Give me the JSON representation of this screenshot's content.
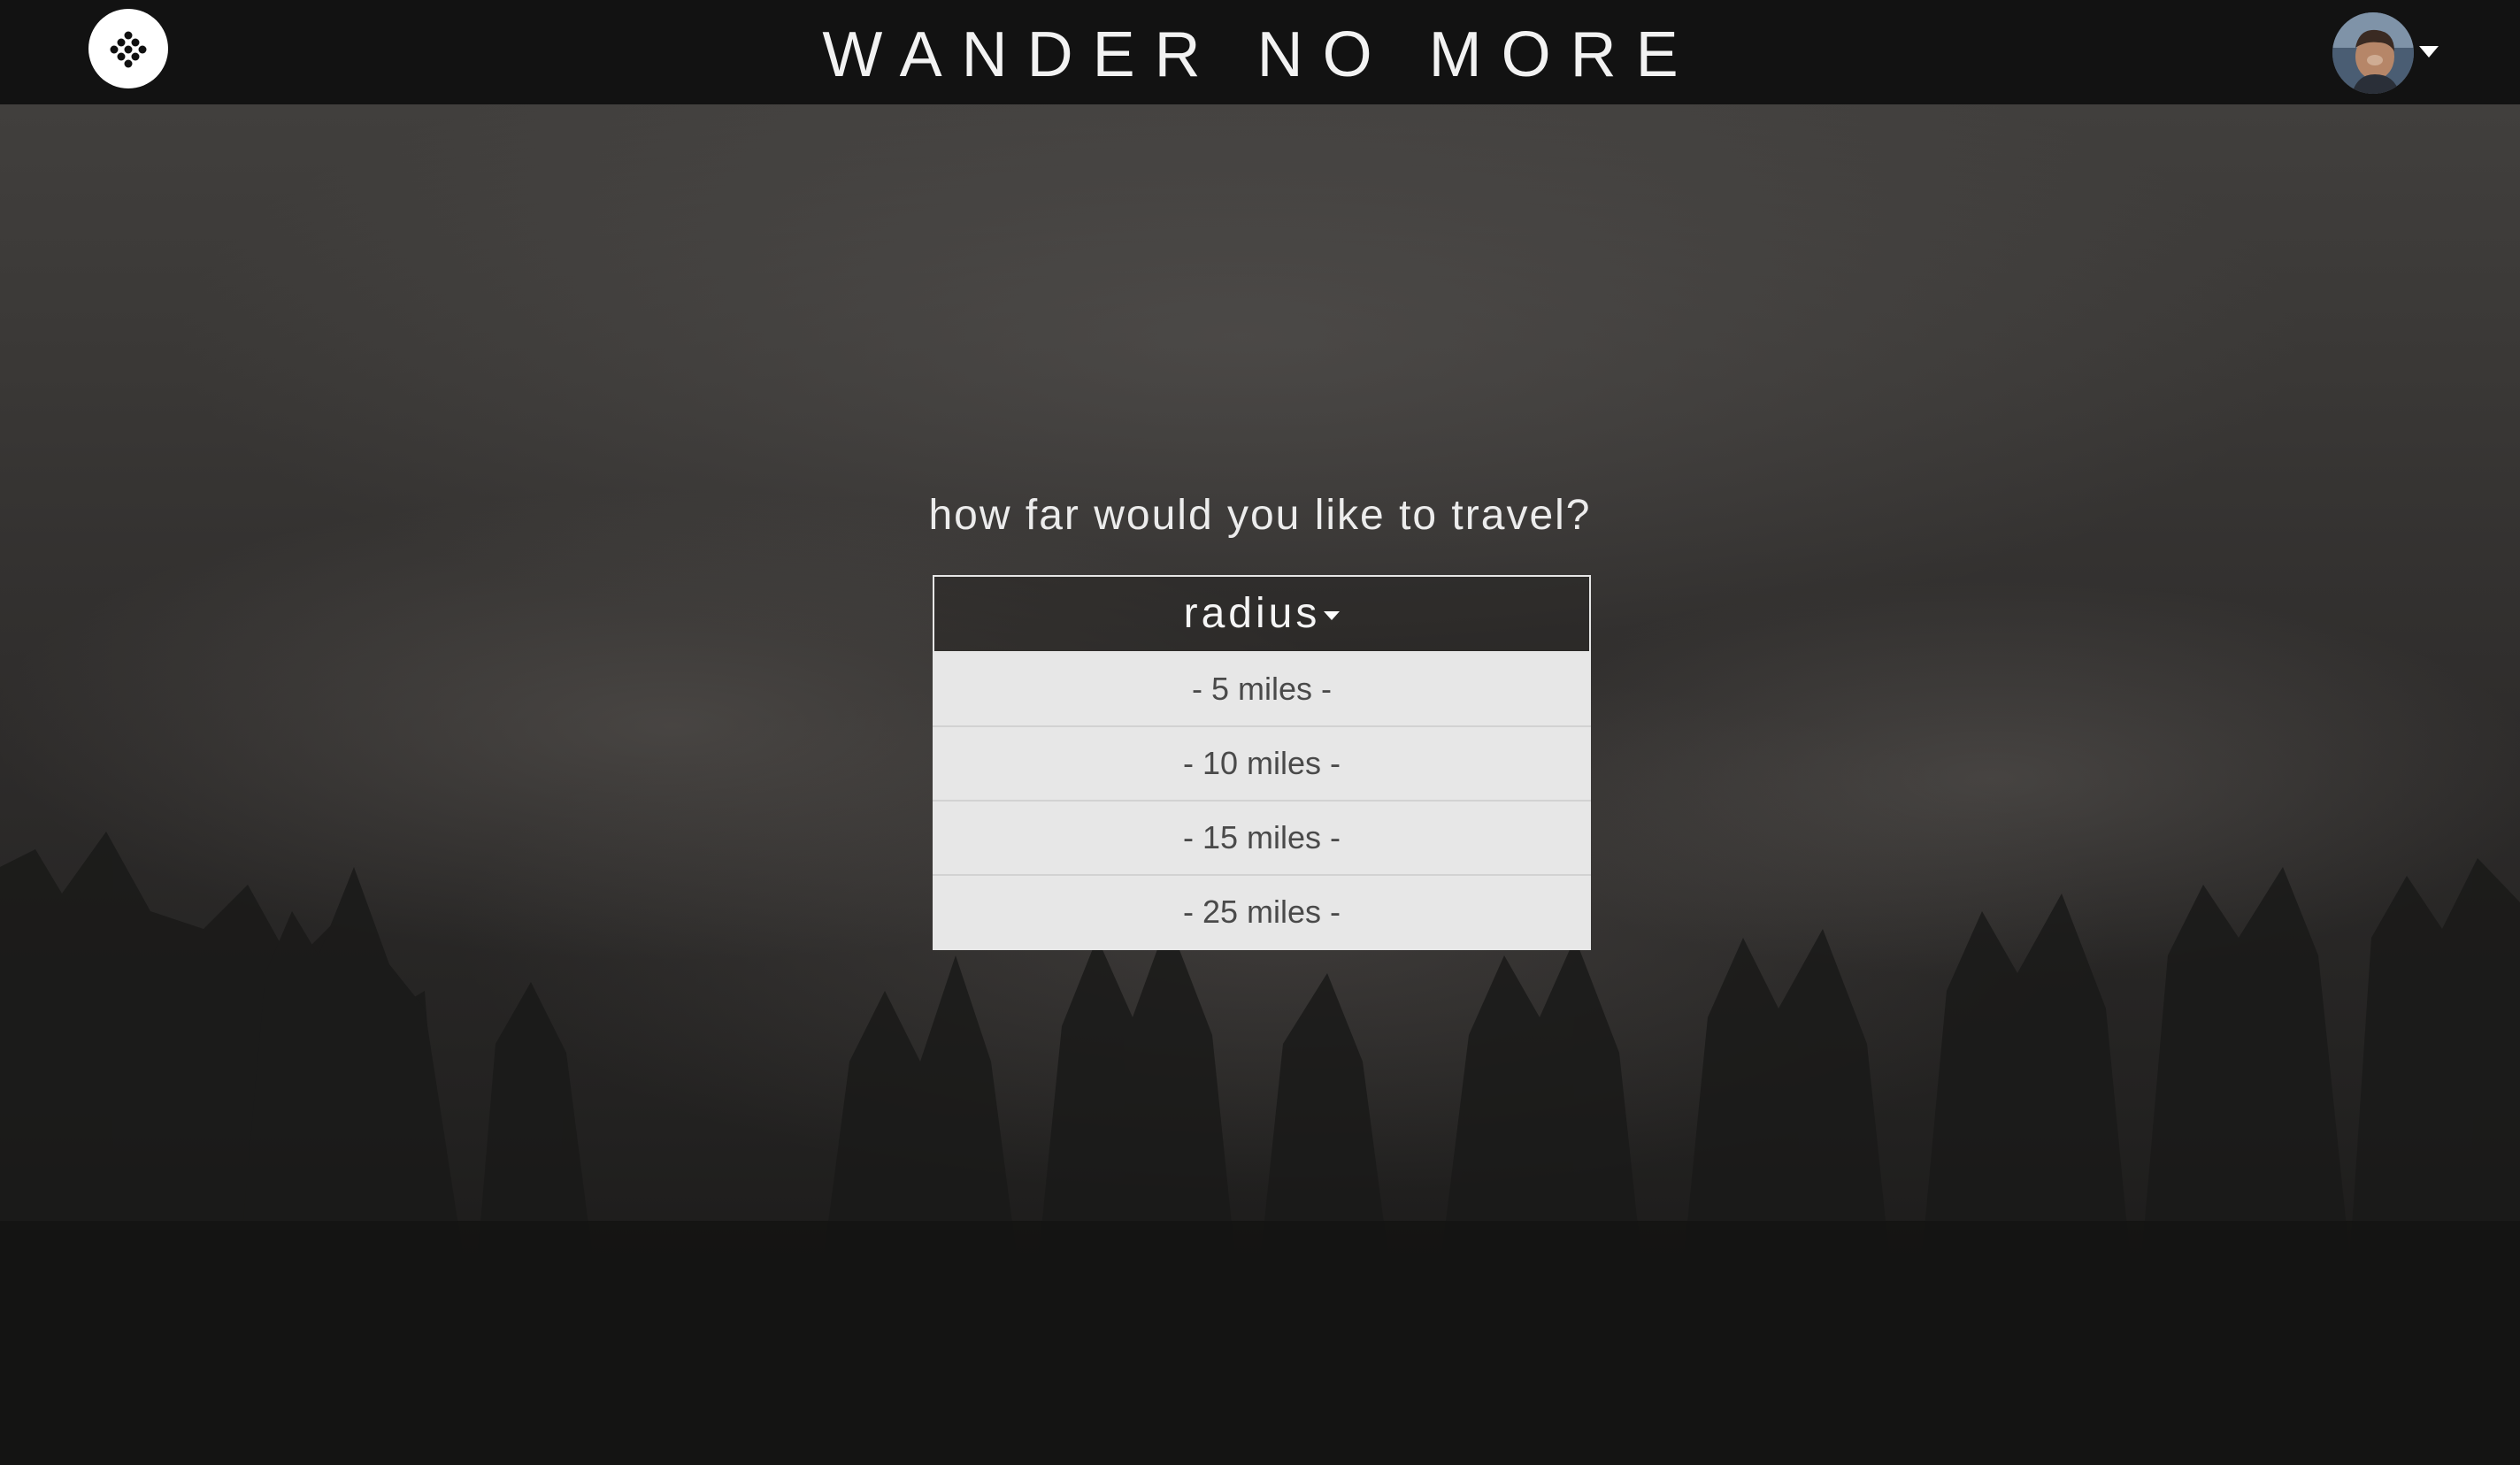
{
  "header": {
    "brand": "WANDER NO MORE",
    "logo_icon": "dots-diamond-icon",
    "user_avatar": "user-avatar",
    "user_menu_icon": "caret-down-icon"
  },
  "main": {
    "question": "how far would you like to travel?",
    "radius_dropdown": {
      "label": "radius",
      "options": [
        "- 5 miles -",
        "- 10 miles -",
        "- 15 miles -",
        "- 25 miles -"
      ]
    }
  },
  "colors": {
    "topbar": "#121212",
    "menu_background": "#e7e7e7",
    "text_light": "#f5f5f5",
    "menu_text": "#4a4a4a"
  }
}
